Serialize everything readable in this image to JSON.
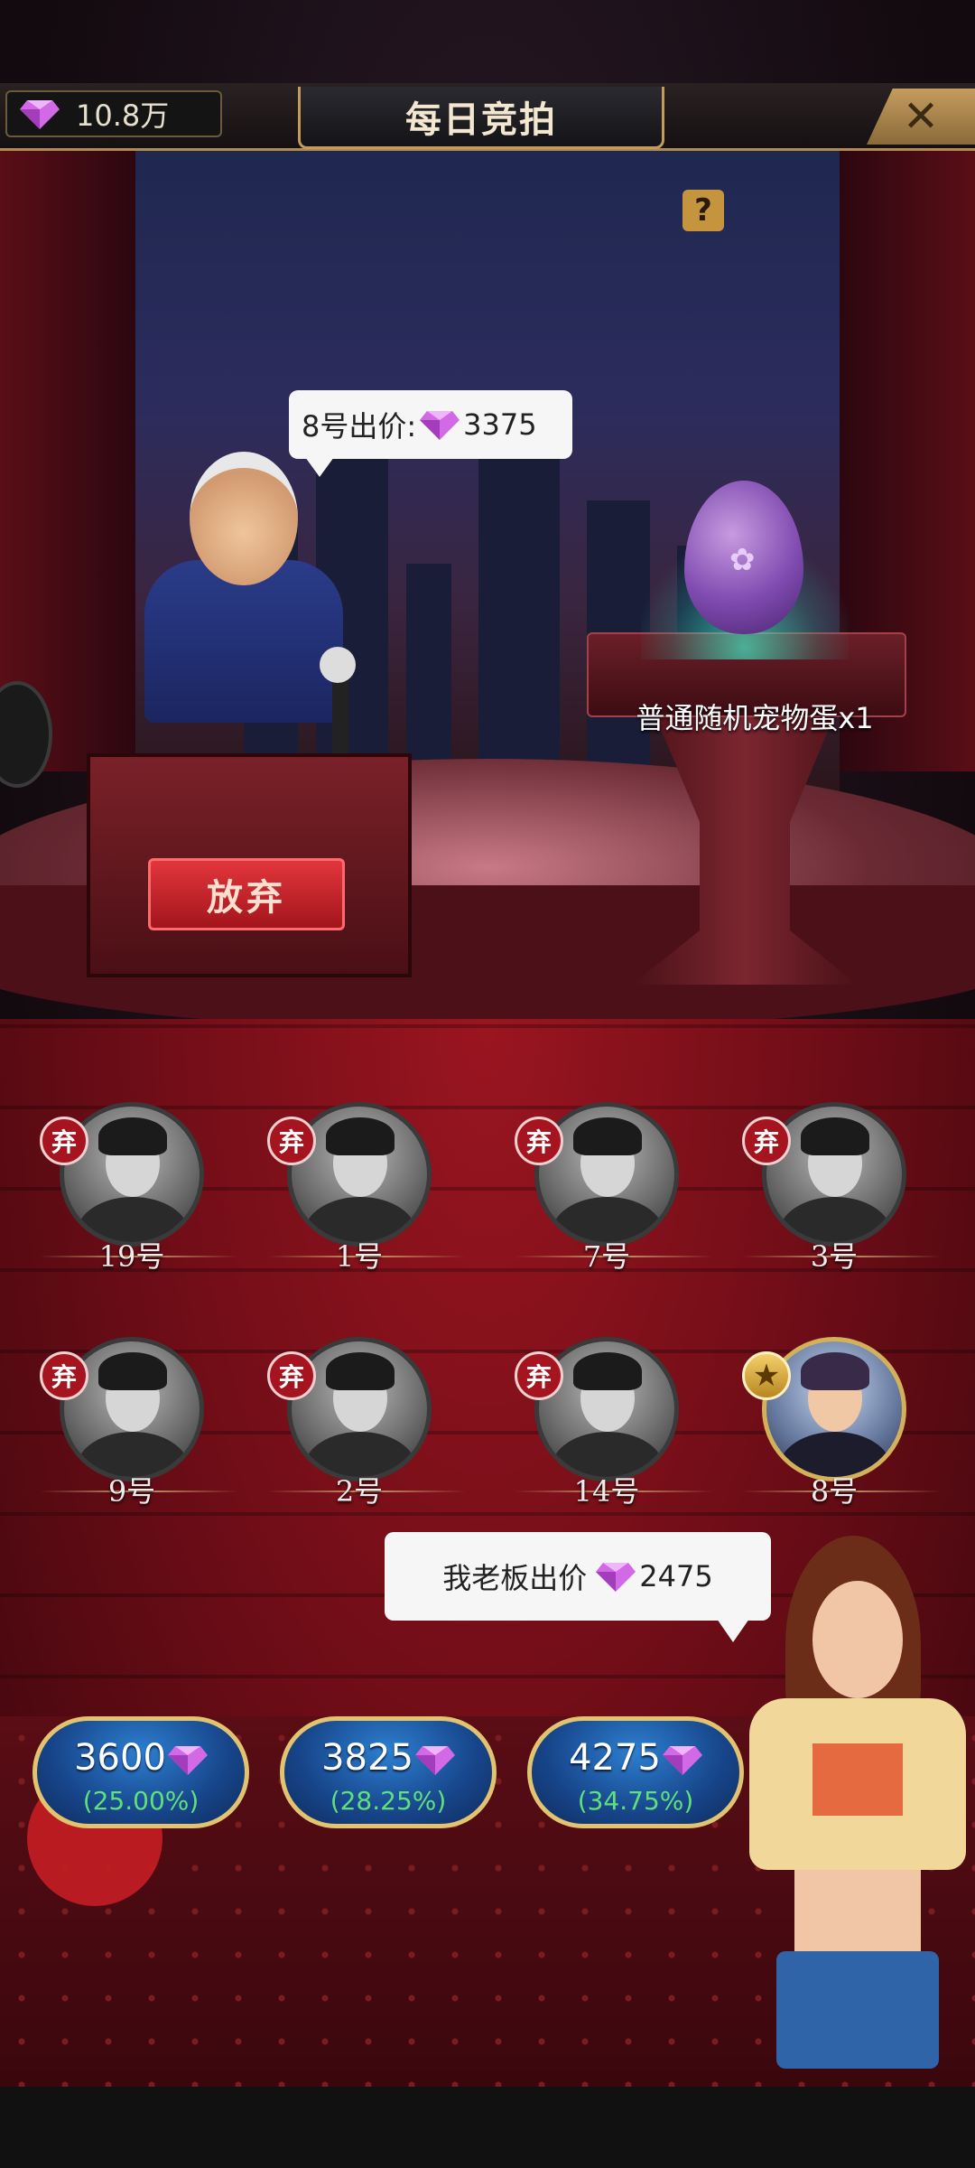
{
  "header": {
    "title": "每日竞拍",
    "gem_balance": "10.8万",
    "help_icon": "question-mark-icon",
    "close_icon": "close-icon"
  },
  "auction": {
    "current_bid_prefix": "8号出价:",
    "current_bid_amount": "3375",
    "item_name": "普通随机宠物蛋x1",
    "give_up_label": "放弃"
  },
  "bidders": [
    {
      "name": "19号",
      "status": "弃",
      "status_type": "fold"
    },
    {
      "name": "1号",
      "status": "弃",
      "status_type": "fold"
    },
    {
      "name": "7号",
      "status": "弃",
      "status_type": "fold"
    },
    {
      "name": "3号",
      "status": "弃",
      "status_type": "fold"
    },
    {
      "name": "9号",
      "status": "弃",
      "status_type": "fold"
    },
    {
      "name": "2号",
      "status": "弃",
      "status_type": "fold"
    },
    {
      "name": "14号",
      "status": "弃",
      "status_type": "fold"
    },
    {
      "name": "8号",
      "status": "★",
      "status_type": "leading"
    }
  ],
  "assistant": {
    "bubble_prefix": "我老板出价",
    "bubble_amount": "2475"
  },
  "bid_options": [
    {
      "amount": "3600",
      "percent": "(25.00%)"
    },
    {
      "amount": "3825",
      "percent": "(28.25%)"
    },
    {
      "amount": "4275",
      "percent": "(34.75%)"
    }
  ],
  "colors": {
    "gold_border": "#e2c36f",
    "bid_button_blue": "#17458a",
    "percent_green": "#60e07a",
    "fold_badge_red": "#a61420",
    "gem_purple": "#c35bd9"
  }
}
